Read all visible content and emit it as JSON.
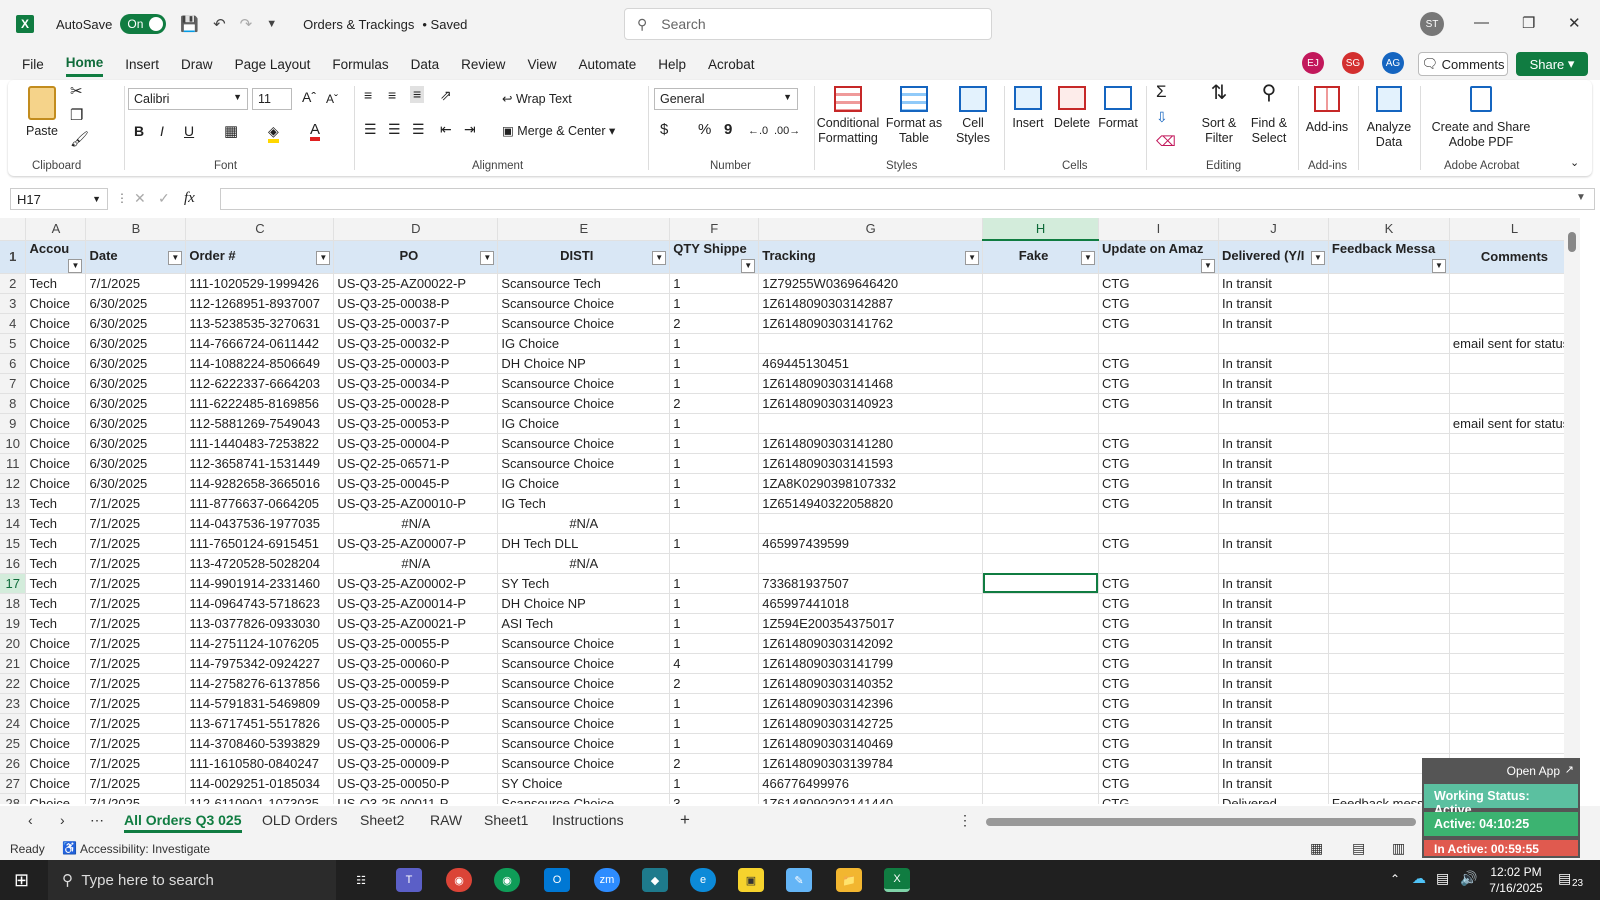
{
  "title_bar": {
    "autosave_label": "AutoSave",
    "autosave_state": "On",
    "document_title": "Orders & Trackings",
    "save_status": "• Saved",
    "search_placeholder": "Search",
    "user_initials": "ST"
  },
  "menu": {
    "items": [
      "File",
      "Home",
      "Insert",
      "Draw",
      "Page Layout",
      "Formulas",
      "Data",
      "Review",
      "View",
      "Automate",
      "Help",
      "Acrobat"
    ],
    "active": "Home",
    "collaborators": [
      "EJ",
      "SG",
      "AG"
    ],
    "comments_label": "Comments",
    "share_label": "Share"
  },
  "ribbon": {
    "clipboard": {
      "paste": "Paste",
      "group": "Clipboard"
    },
    "font": {
      "name": "Calibri",
      "size": "11",
      "bold": "B",
      "italic": "I",
      "underline": "U",
      "group": "Font"
    },
    "alignment": {
      "wrap": "Wrap Text",
      "merge": "Merge & Center",
      "group": "Alignment"
    },
    "number": {
      "format": "General",
      "currency": "$",
      "percent": "%",
      "comma": "9",
      "group": "Number"
    },
    "styles": {
      "conditional": "Conditional Formatting",
      "format_table": "Format as Table",
      "cell_styles": "Cell Styles",
      "group": "Styles"
    },
    "cells": {
      "insert": "Insert",
      "delete": "Delete",
      "format": "Format",
      "group": "Cells"
    },
    "editing": {
      "sort": "Sort & Filter",
      "find": "Find & Select",
      "group": "Editing"
    },
    "addins": {
      "addins": "Add-ins",
      "group": "Add-ins"
    },
    "analyze": {
      "label": "Analyze Data"
    },
    "acrobat": {
      "label": "Create and Share Adobe PDF",
      "group": "Adobe Acrobat"
    }
  },
  "formula_bar": {
    "name_box": "H17",
    "fx": "fx",
    "value": ""
  },
  "columns": [
    "A",
    "B",
    "C",
    "D",
    "E",
    "F",
    "G",
    "H",
    "I",
    "J",
    "K",
    "L"
  ],
  "header_row": [
    "Accou",
    "Date",
    "Order #",
    "PO",
    "DISTI",
    "QTY Shippe",
    "Tracking",
    "Fake",
    "Update on Amaz",
    "Delivered (Y/I",
    "Feedback Messa",
    "Comments"
  ],
  "rows": [
    {
      "n": "2",
      "cells": [
        "Tech",
        "7/1/2025",
        "111-1020529-1999426",
        "US-Q3-25-AZ00022-P",
        "Scansource Tech",
        "1",
        "1Z79255W0369646420",
        "",
        "CTG",
        "In transit",
        "",
        ""
      ]
    },
    {
      "n": "3",
      "cells": [
        "Choice",
        "6/30/2025",
        "112-1268951-8937007",
        "US-Q3-25-00038-P",
        "Scansource Choice",
        "1",
        "1Z6148090303142887",
        "",
        "CTG",
        "In transit",
        "",
        ""
      ]
    },
    {
      "n": "4",
      "cells": [
        "Choice",
        "6/30/2025",
        "113-5238535-3270631",
        "US-Q3-25-00037-P",
        "Scansource Choice",
        "2",
        "1Z6148090303141762",
        "",
        "CTG",
        "In transit",
        "",
        ""
      ]
    },
    {
      "n": "5",
      "cells": [
        "Choice",
        "6/30/2025",
        "114-7666724-0611442",
        "US-Q3-25-00032-P",
        "IG Choice",
        "1",
        "",
        "",
        "",
        "",
        "",
        "email sent for status"
      ]
    },
    {
      "n": "6",
      "cells": [
        "Choice",
        "6/30/2025",
        "114-1088224-8506649",
        "US-Q3-25-00003-P",
        "DH Choice NP",
        "1",
        "469445130451",
        "",
        "CTG",
        "In transit",
        "",
        ""
      ]
    },
    {
      "n": "7",
      "cells": [
        "Choice",
        "6/30/2025",
        "112-6222337-6664203",
        "US-Q3-25-00034-P",
        "Scansource Choice",
        "1",
        "1Z6148090303141468",
        "",
        "CTG",
        "In transit",
        "",
        ""
      ]
    },
    {
      "n": "8",
      "cells": [
        "Choice",
        "6/30/2025",
        "111-6222485-8169856",
        "US-Q3-25-00028-P",
        "Scansource Choice",
        "2",
        "1Z6148090303140923",
        "",
        "CTG",
        "In transit",
        "",
        ""
      ]
    },
    {
      "n": "9",
      "cells": [
        "Choice",
        "6/30/2025",
        "112-5881269-7549043",
        "US-Q3-25-00053-P",
        "IG Choice",
        "1",
        "",
        "",
        "",
        "",
        "",
        "email sent for status"
      ]
    },
    {
      "n": "10",
      "cells": [
        "Choice",
        "6/30/2025",
        "111-1440483-7253822",
        "US-Q3-25-00004-P",
        "Scansource Choice",
        "1",
        "1Z6148090303141280",
        "",
        "CTG",
        "In transit",
        "",
        ""
      ]
    },
    {
      "n": "11",
      "cells": [
        "Choice",
        "6/30/2025",
        "112-3658741-1531449",
        "US-Q2-25-06571-P",
        "Scansource Choice",
        "1",
        "1Z6148090303141593",
        "",
        "CTG",
        "In transit",
        "",
        ""
      ]
    },
    {
      "n": "12",
      "cells": [
        "Choice",
        "6/30/2025",
        "114-9282658-3665016",
        "US-Q3-25-00045-P",
        "IG Choice",
        "1",
        "1ZA8K0290398107332",
        "",
        "CTG",
        "In transit",
        "",
        ""
      ]
    },
    {
      "n": "13",
      "cells": [
        "Tech",
        "7/1/2025",
        "111-8776637-0664205",
        "US-Q3-25-AZ00010-P",
        "IG Tech",
        "1",
        "1Z6514940322058820",
        "",
        "CTG",
        "In transit",
        "",
        ""
      ]
    },
    {
      "n": "14",
      "cells": [
        "Tech",
        "7/1/2025",
        "114-0437536-1977035",
        "#N/A",
        "#N/A",
        "",
        "",
        "",
        "",
        "",
        "",
        ""
      ]
    },
    {
      "n": "15",
      "cells": [
        "Tech",
        "7/1/2025",
        "111-7650124-6915451",
        "US-Q3-25-AZ00007-P",
        "DH Tech DLL",
        "1",
        "465997439599",
        "",
        "CTG",
        "In transit",
        "",
        ""
      ]
    },
    {
      "n": "16",
      "cells": [
        "Tech",
        "7/1/2025",
        "113-4720528-5028204",
        "#N/A",
        "#N/A",
        "",
        "",
        "",
        "",
        "",
        "",
        ""
      ]
    },
    {
      "n": "17",
      "cells": [
        "Tech",
        "7/1/2025",
        "114-9901914-2331460",
        "US-Q3-25-AZ00002-P",
        "SY Tech",
        "1",
        "733681937507",
        "",
        "CTG",
        "In transit",
        "",
        ""
      ]
    },
    {
      "n": "18",
      "cells": [
        "Tech",
        "7/1/2025",
        "114-0964743-5718623",
        "US-Q3-25-AZ00014-P",
        "DH Choice NP",
        "1",
        "465997441018",
        "",
        "CTG",
        "In transit",
        "",
        ""
      ]
    },
    {
      "n": "19",
      "cells": [
        "Tech",
        "7/1/2025",
        "113-0377826-0933030",
        "US-Q3-25-AZ00021-P",
        "ASI Tech",
        "1",
        "1Z594E200354375017",
        "",
        "CTG",
        "In transit",
        "",
        ""
      ]
    },
    {
      "n": "20",
      "cells": [
        "Choice",
        "7/1/2025",
        "114-2751124-1076205",
        "US-Q3-25-00055-P",
        "Scansource Choice",
        "1",
        "1Z6148090303142092",
        "",
        "CTG",
        "In transit",
        "",
        ""
      ]
    },
    {
      "n": "21",
      "cells": [
        "Choice",
        "7/1/2025",
        "114-7975342-0924227",
        "US-Q3-25-00060-P",
        "Scansource Choice",
        "4",
        "1Z6148090303141799",
        "",
        "CTG",
        "In transit",
        "",
        ""
      ]
    },
    {
      "n": "22",
      "cells": [
        "Choice",
        "7/1/2025",
        "114-2758276-6137856",
        "US-Q3-25-00059-P",
        "Scansource Choice",
        "2",
        "1Z6148090303140352",
        "",
        "CTG",
        "In transit",
        "",
        ""
      ]
    },
    {
      "n": "23",
      "cells": [
        "Choice",
        "7/1/2025",
        "114-5791831-5469809",
        "US-Q3-25-00058-P",
        "Scansource Choice",
        "1",
        "1Z6148090303142396",
        "",
        "CTG",
        "In transit",
        "",
        ""
      ]
    },
    {
      "n": "24",
      "cells": [
        "Choice",
        "7/1/2025",
        "113-6717451-5517826",
        "US-Q3-25-00005-P",
        "Scansource Choice",
        "1",
        "1Z6148090303142725",
        "",
        "CTG",
        "In transit",
        "",
        ""
      ]
    },
    {
      "n": "25",
      "cells": [
        "Choice",
        "7/1/2025",
        "114-3708460-5393829",
        "US-Q3-25-00006-P",
        "Scansource Choice",
        "1",
        "1Z6148090303140469",
        "",
        "CTG",
        "In transit",
        "",
        ""
      ]
    },
    {
      "n": "26",
      "cells": [
        "Choice",
        "7/1/2025",
        "111-1610580-0840247",
        "US-Q3-25-00009-P",
        "Scansource Choice",
        "2",
        "1Z6148090303139784",
        "",
        "CTG",
        "In transit",
        "",
        ""
      ]
    },
    {
      "n": "27",
      "cells": [
        "Choice",
        "7/1/2025",
        "114-0029251-0185034",
        "US-Q3-25-00050-P",
        "SY Choice",
        "1",
        "466776499976",
        "",
        "CTG",
        "In transit",
        "",
        ""
      ]
    },
    {
      "n": "28",
      "cells": [
        "Choice",
        "7/1/2025",
        "112-6110901-1073035",
        "US-Q3-25-00011-P",
        "Scansource Choice",
        "3",
        "1Z6148090303141440",
        "",
        "CTG",
        "Delivered",
        "Feedback message",
        ""
      ]
    }
  ],
  "sheet_tabs": [
    "All Orders Q3 025",
    "OLD Orders",
    "Sheet2",
    "RAW",
    "Sheet1",
    "Instructions"
  ],
  "active_tab": "All Orders Q3 025",
  "status": {
    "ready": "Ready",
    "accessibility": "Accessibility: Investigate"
  },
  "overlay": {
    "open_app": "Open App",
    "working_status": "Working Status: Active",
    "active_time": "Active: 04:10:25",
    "inactive_time": "In Active: 00:59:55"
  },
  "taskbar": {
    "search_placeholder": "Type here to search",
    "time": "12:02 PM",
    "date": "7/16/2025",
    "notifications": "23"
  },
  "colors": {
    "excel_green": "#107c41",
    "table_header": "#d9e7f5",
    "overlay_green": "#3cb371",
    "overlay_red": "#e05a4f"
  }
}
